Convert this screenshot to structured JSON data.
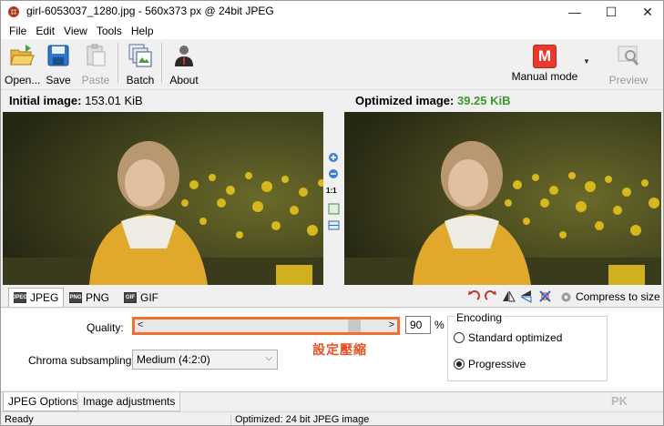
{
  "window": {
    "title": "girl-6053037_1280.jpg - 560x373 px @ 24bit JPEG",
    "minimize": "—",
    "maximize": "☐",
    "close": "✕"
  },
  "menu": [
    "File",
    "Edit",
    "View",
    "Tools",
    "Help"
  ],
  "toolbar": {
    "open": "Open...",
    "save": "Save",
    "paste": "Paste",
    "batch": "Batch",
    "about": "About",
    "mode_letter": "M",
    "mode_label": "Manual mode",
    "preview": "Preview"
  },
  "header": {
    "initial_label": "Initial image:",
    "initial_value": "153.01 KiB",
    "optimized_label": "Optimized image:",
    "optimized_value": "39.25 KiB"
  },
  "view_tools": {
    "zoom_ratio": "1:1"
  },
  "format_tabs": [
    {
      "label": "JPEG",
      "icon": "JPEG",
      "active": true
    },
    {
      "label": "PNG",
      "icon": "PNG",
      "active": false
    },
    {
      "label": "GIF",
      "icon": "GIF",
      "active": false
    }
  ],
  "compress_to_size": "Compress to size",
  "options": {
    "quality_label": "Quality:",
    "quality_value": "90",
    "quality_fraction": 0.9,
    "quality_unit": "%",
    "annotation": "設定壓縮",
    "chroma_label": "Chroma subsampling:",
    "chroma_value": "Medium (4:2:0)",
    "encoding_title": "Encoding",
    "encoding_options": [
      {
        "label": "Standard optimized",
        "selected": false
      },
      {
        "label": "Progressive",
        "selected": true
      }
    ]
  },
  "bottom_tabs": [
    {
      "label": "JPEG Options",
      "active": true
    },
    {
      "label": "Image adjustments",
      "active": false
    }
  ],
  "watermark": "PK",
  "status": {
    "left": "Ready",
    "middle": "Optimized: 24 bit JPEG image"
  },
  "colors": {
    "annotation": "#e85020",
    "optimized_size": "#3a9a2a",
    "mode_badge": "#e8392a"
  }
}
